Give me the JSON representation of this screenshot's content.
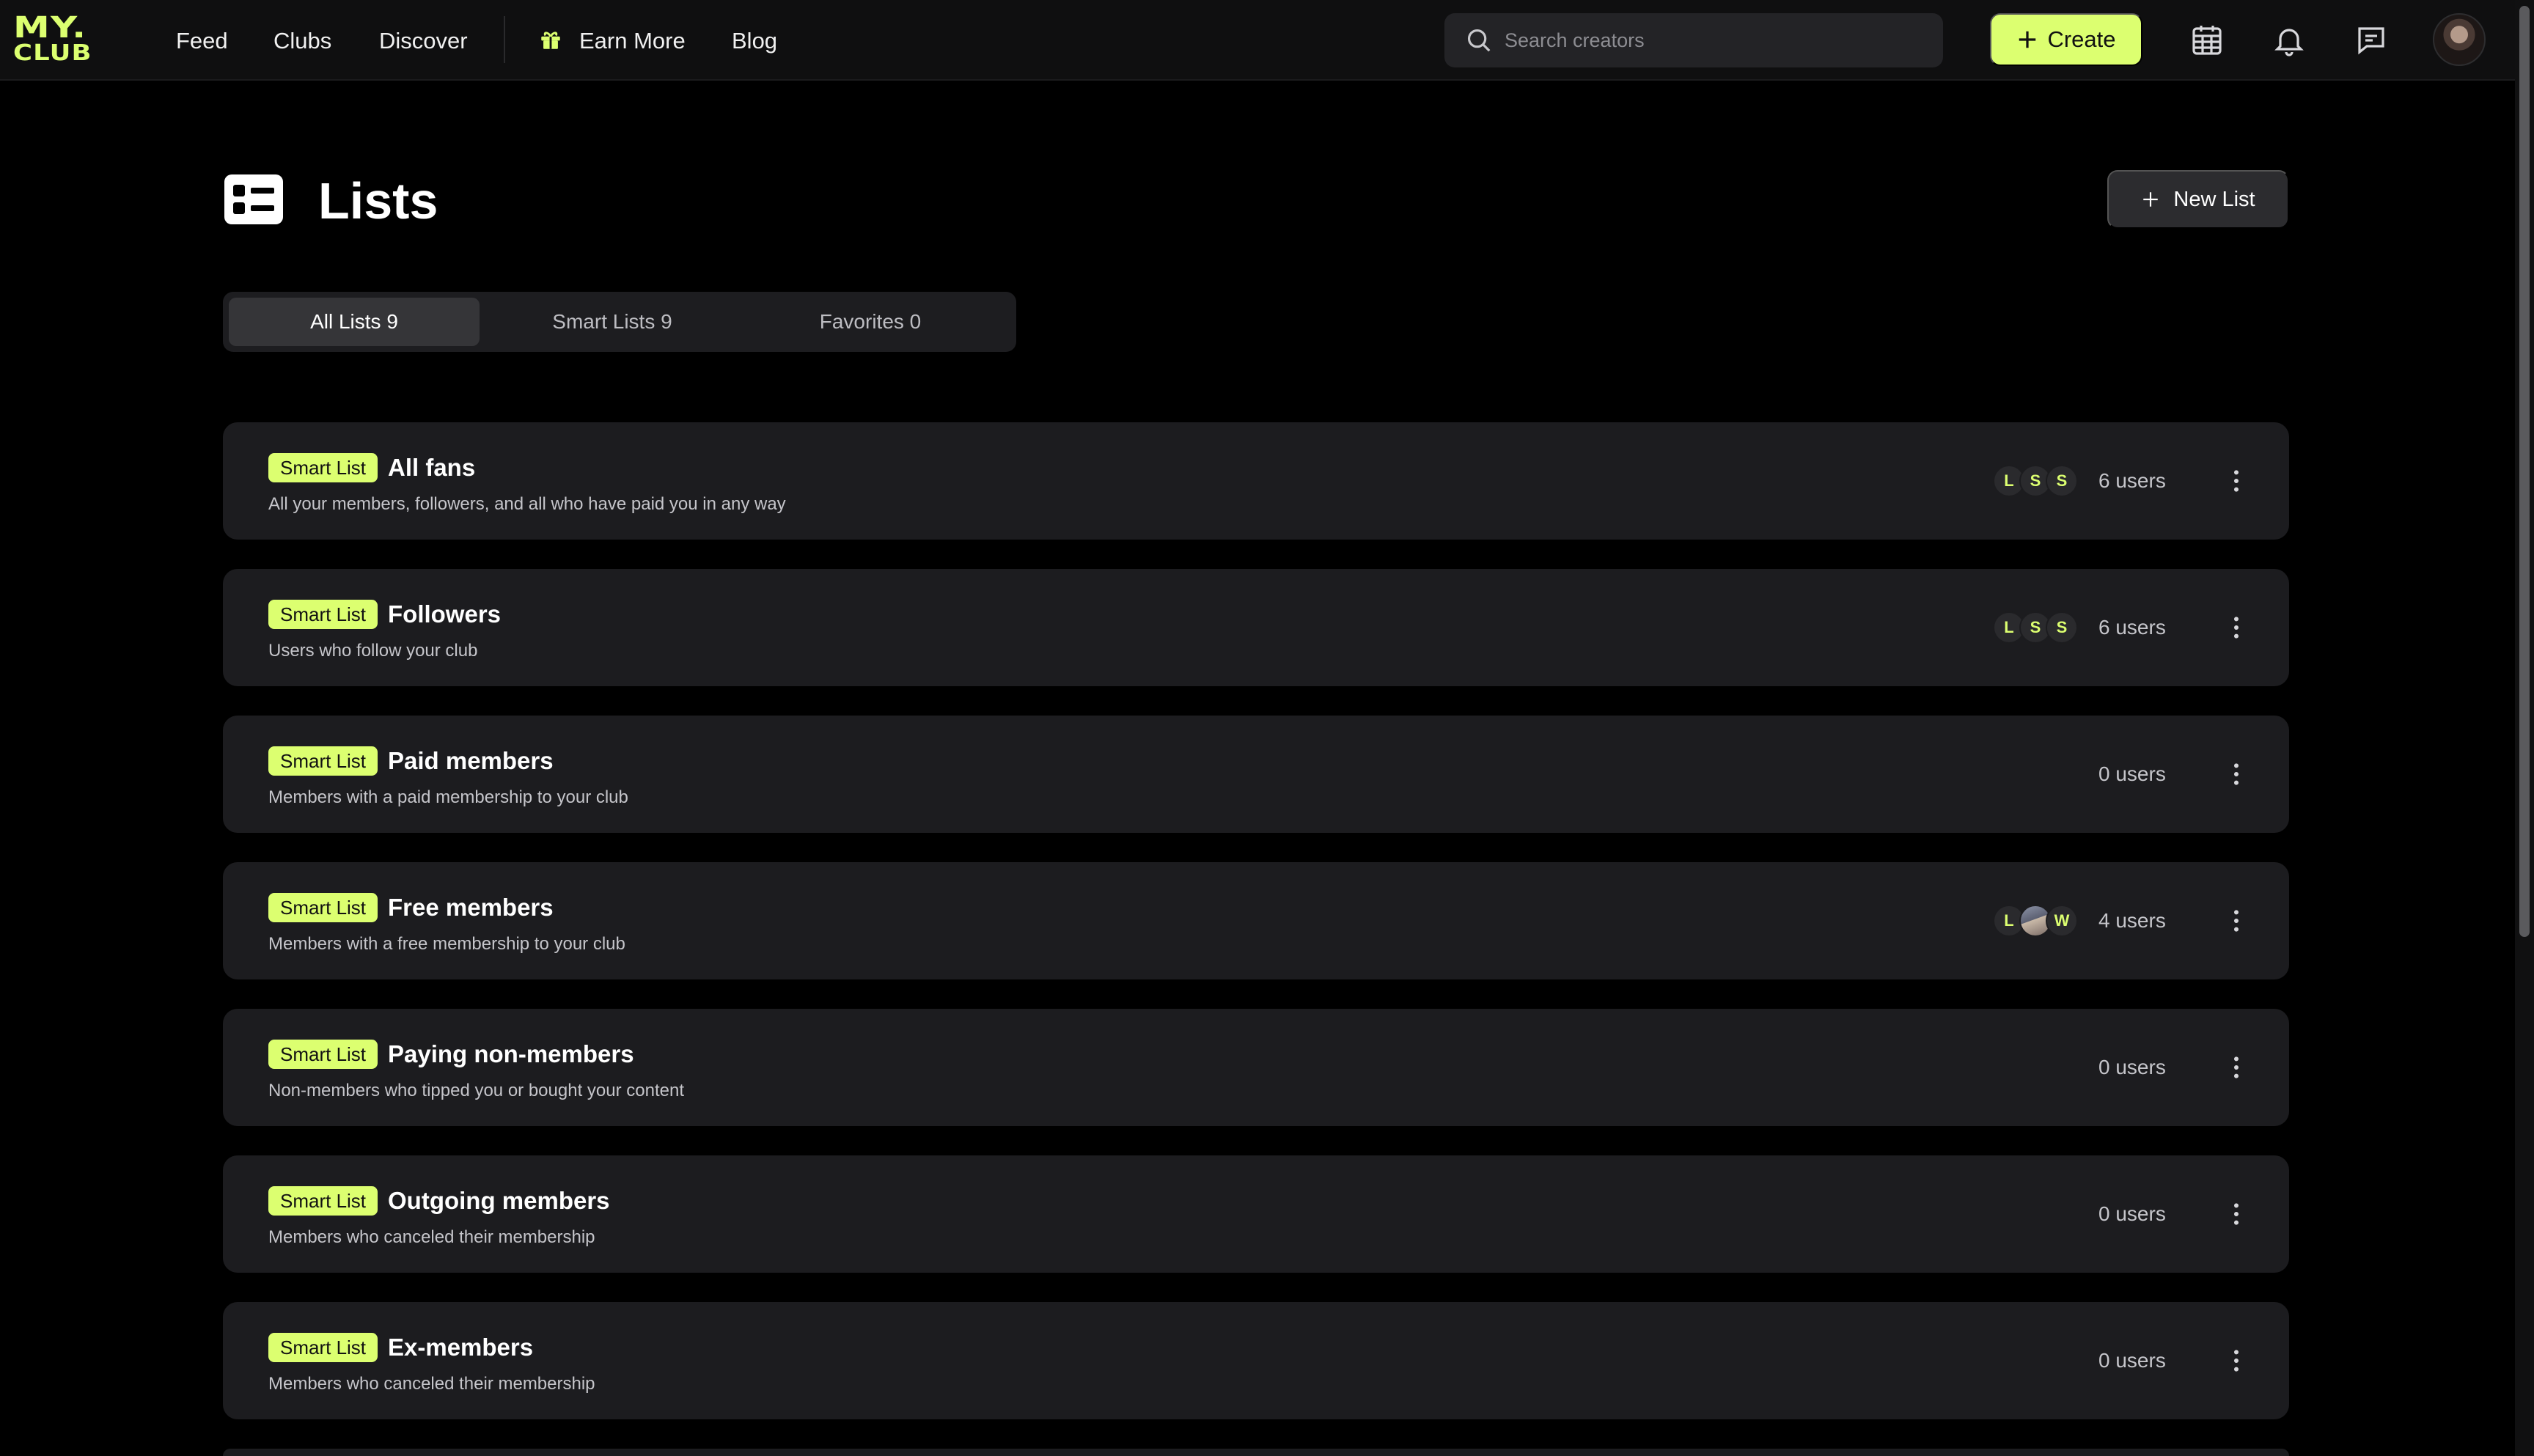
{
  "brand": {
    "logo_line1": "MY.",
    "logo_line2": "CLUB",
    "accent": "#dcff70"
  },
  "nav": [
    {
      "label": "Feed"
    },
    {
      "label": "Clubs"
    },
    {
      "label": "Discover"
    },
    {
      "label": "Earn More"
    },
    {
      "label": "Blog"
    }
  ],
  "search": {
    "placeholder": "Search creators"
  },
  "create_label": "Create",
  "icons": {
    "gift": "gift-icon",
    "search": "search-icon",
    "calendar": "calendar-icon",
    "bell": "bell-icon",
    "messages": "chat-icon",
    "page": "list-icon",
    "more": "more-vertical-icon",
    "plus": "plus-icon"
  },
  "page": {
    "title": "Lists",
    "new_list_label": "New List"
  },
  "tabs": [
    {
      "label": "All Lists 9",
      "active": true
    },
    {
      "label": "Smart Lists 9",
      "active": false
    },
    {
      "label": "Favorites 0",
      "active": false
    }
  ],
  "lists": [
    {
      "badge": "Smart List",
      "title": "All fans",
      "description": "All your members, followers, and all who have paid you in any way",
      "avatars": [
        "L",
        "S",
        "S"
      ],
      "users": "6 users"
    },
    {
      "badge": "Smart List",
      "title": "Followers",
      "description": "Users who follow your club",
      "avatars": [
        "L",
        "S",
        "S"
      ],
      "users": "6 users"
    },
    {
      "badge": "Smart List",
      "title": "Paid members",
      "description": "Members with a paid membership to your club",
      "avatars": [],
      "users": "0 users"
    },
    {
      "badge": "Smart List",
      "title": "Free members",
      "description": "Members with a free membership to your club",
      "avatars": [
        "L",
        "",
        "W"
      ],
      "users": "4 users"
    },
    {
      "badge": "Smart List",
      "title": "Paying non-members",
      "description": "Non-members who tipped you or bought your content",
      "avatars": [],
      "users": "0 users"
    },
    {
      "badge": "Smart List",
      "title": "Outgoing members",
      "description": "Members who canceled their membership",
      "avatars": [],
      "users": "0 users"
    },
    {
      "badge": "Smart List",
      "title": "Ex-members",
      "description": "Members who canceled their membership",
      "avatars": [],
      "users": "0 users"
    }
  ]
}
